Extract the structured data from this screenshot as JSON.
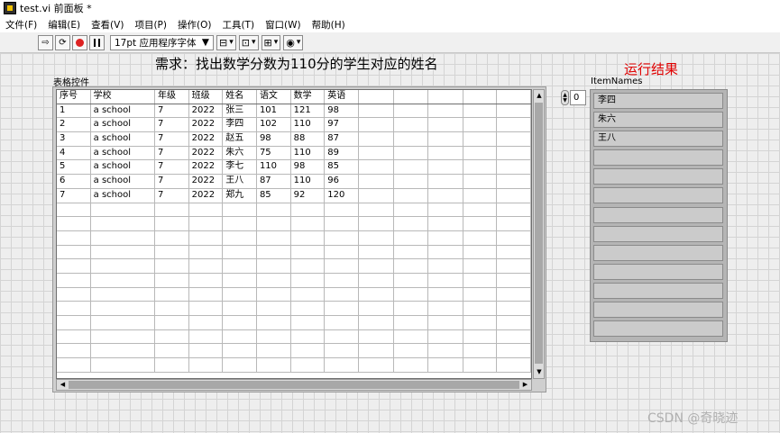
{
  "window": {
    "title": "test.vi 前面板 *"
  },
  "menu": [
    "文件(F)",
    "编辑(E)",
    "查看(V)",
    "项目(P)",
    "操作(O)",
    "工具(T)",
    "窗口(W)",
    "帮助(H)"
  ],
  "toolbar": {
    "font_select": "17pt 应用程序字体",
    "icons": [
      "run-arrow",
      "run-continuously",
      "abort",
      "pause",
      "align",
      "distribute",
      "resize",
      "reorder"
    ]
  },
  "front_panel": {
    "heading": "需求：找出数学分数为110分的学生对应的姓名",
    "result_label": "运行结果",
    "result_label_color": "#e00000",
    "table": {
      "label": "表格控件",
      "headers": [
        "序号",
        "学校",
        "年级",
        "班级",
        "姓名",
        "语文",
        "数学",
        "英语"
      ],
      "rows": [
        [
          "1",
          "a school",
          "7",
          "2022",
          "张三",
          "101",
          "121",
          "98"
        ],
        [
          "2",
          "a school",
          "7",
          "2022",
          "李四",
          "102",
          "110",
          "97"
        ],
        [
          "3",
          "a school",
          "7",
          "2022",
          "赵五",
          "98",
          "88",
          "87"
        ],
        [
          "4",
          "a school",
          "7",
          "2022",
          "朱六",
          "75",
          "110",
          "89"
        ],
        [
          "5",
          "a school",
          "7",
          "2022",
          "李七",
          "110",
          "98",
          "85"
        ],
        [
          "6",
          "a school",
          "7",
          "2022",
          "王八",
          "87",
          "110",
          "96"
        ],
        [
          "7",
          "a school",
          "7",
          "2022",
          "郑九",
          "85",
          "92",
          "120"
        ]
      ]
    },
    "item_names": {
      "label": "ItemNames",
      "index": "0",
      "items": [
        "李四",
        "朱六",
        "王八"
      ]
    }
  },
  "watermark": "CSDN @奇晓迹"
}
